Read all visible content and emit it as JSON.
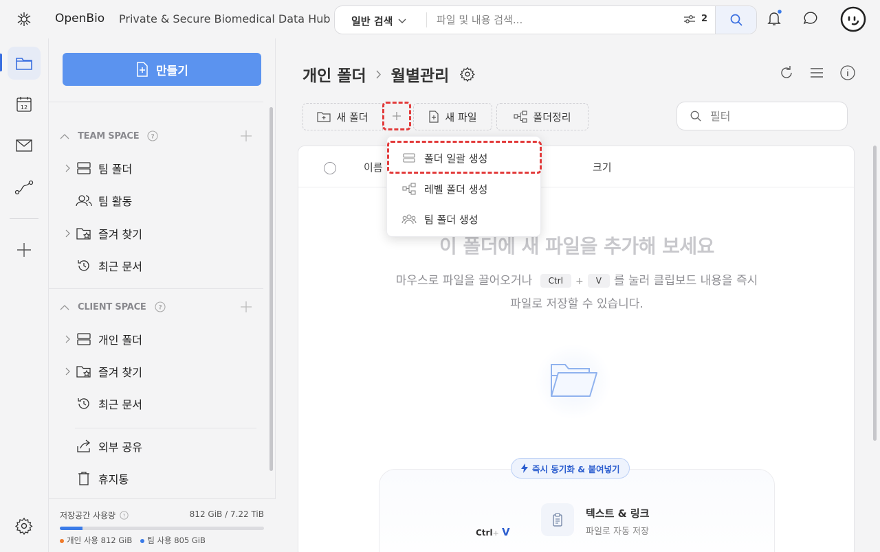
{
  "app": {
    "brand": "OpenBio",
    "tagline": "Private & Secure Biomedical Data Hub"
  },
  "search": {
    "mode_label": "일반 검색",
    "placeholder": "파일 및 내용 검색...",
    "filter_count": "2"
  },
  "rail": {
    "icons": [
      "folder-icon",
      "calendar-icon",
      "mail-icon",
      "workflow-icon",
      "plus-icon",
      "settings-icon"
    ],
    "calendar_day": "12"
  },
  "sidebar": {
    "create_label": "만들기",
    "team_space": {
      "title": "TEAM SPACE",
      "items": [
        {
          "label": "팀 폴더",
          "icon": "storage-icon"
        },
        {
          "label": "팀 활동",
          "icon": "users-icon"
        },
        {
          "label": "즐겨 찾기",
          "icon": "star-folder-icon"
        },
        {
          "label": "최근 문서",
          "icon": "history-icon"
        }
      ]
    },
    "client_space": {
      "title": "CLIENT SPACE",
      "items": [
        {
          "label": "개인 폴더",
          "icon": "storage-icon"
        },
        {
          "label": "즐겨 찾기",
          "icon": "star-folder-icon"
        },
        {
          "label": "최근 문서",
          "icon": "history-icon"
        }
      ]
    },
    "extra": [
      {
        "label": "외부 공유",
        "icon": "share-icon"
      },
      {
        "label": "휴지통",
        "icon": "trash-icon"
      }
    ],
    "storage": {
      "label": "저장공간 사용량",
      "total": "812 GiB / 7.22 TiB",
      "used_fraction": 0.11,
      "personal": "개인 사용 812 GiB",
      "team": "팀 사용 805 GiB",
      "personal_color": "#f07a2a",
      "team_color": "#3a7be8"
    }
  },
  "main": {
    "breadcrumb_root": "개인 폴더",
    "breadcrumb_current": "월별관리",
    "toolbar": {
      "new_folder": "새 폴더",
      "new_file": "새 파일",
      "organize": "폴더정리",
      "filter_placeholder": "필터"
    },
    "columns": {
      "name": "이름",
      "size": "크기"
    },
    "empty_title": "이 폴더에 새 파일을 추가해 보세요",
    "empty_desc_1": "마우스로 파일을 끌어오거나",
    "key_ctrl": "Ctrl",
    "key_plus": "+",
    "key_v": "V",
    "empty_desc_2": "를 눌러 클립보드 내용을 즉시 파일로 저장할 수 있습니다.",
    "sync_pill": "즉시 동기화 & 붙여넣기",
    "kb_ctrl": "Ctrl",
    "kb_plus": "+",
    "kb_v": "V",
    "text_link_title": "텍스트 & 링크",
    "text_link_sub": "파일로 자동 저장"
  },
  "dropdown": {
    "items": [
      {
        "label": "폴더 일괄 생성",
        "icon": "batch-folder-icon"
      },
      {
        "label": "레벨 폴더 생성",
        "icon": "tree-folder-icon"
      },
      {
        "label": "팀 폴더 생성",
        "icon": "team-folder-icon"
      }
    ]
  },
  "accent": "#5b93ef",
  "highlight": "#e23a3a"
}
